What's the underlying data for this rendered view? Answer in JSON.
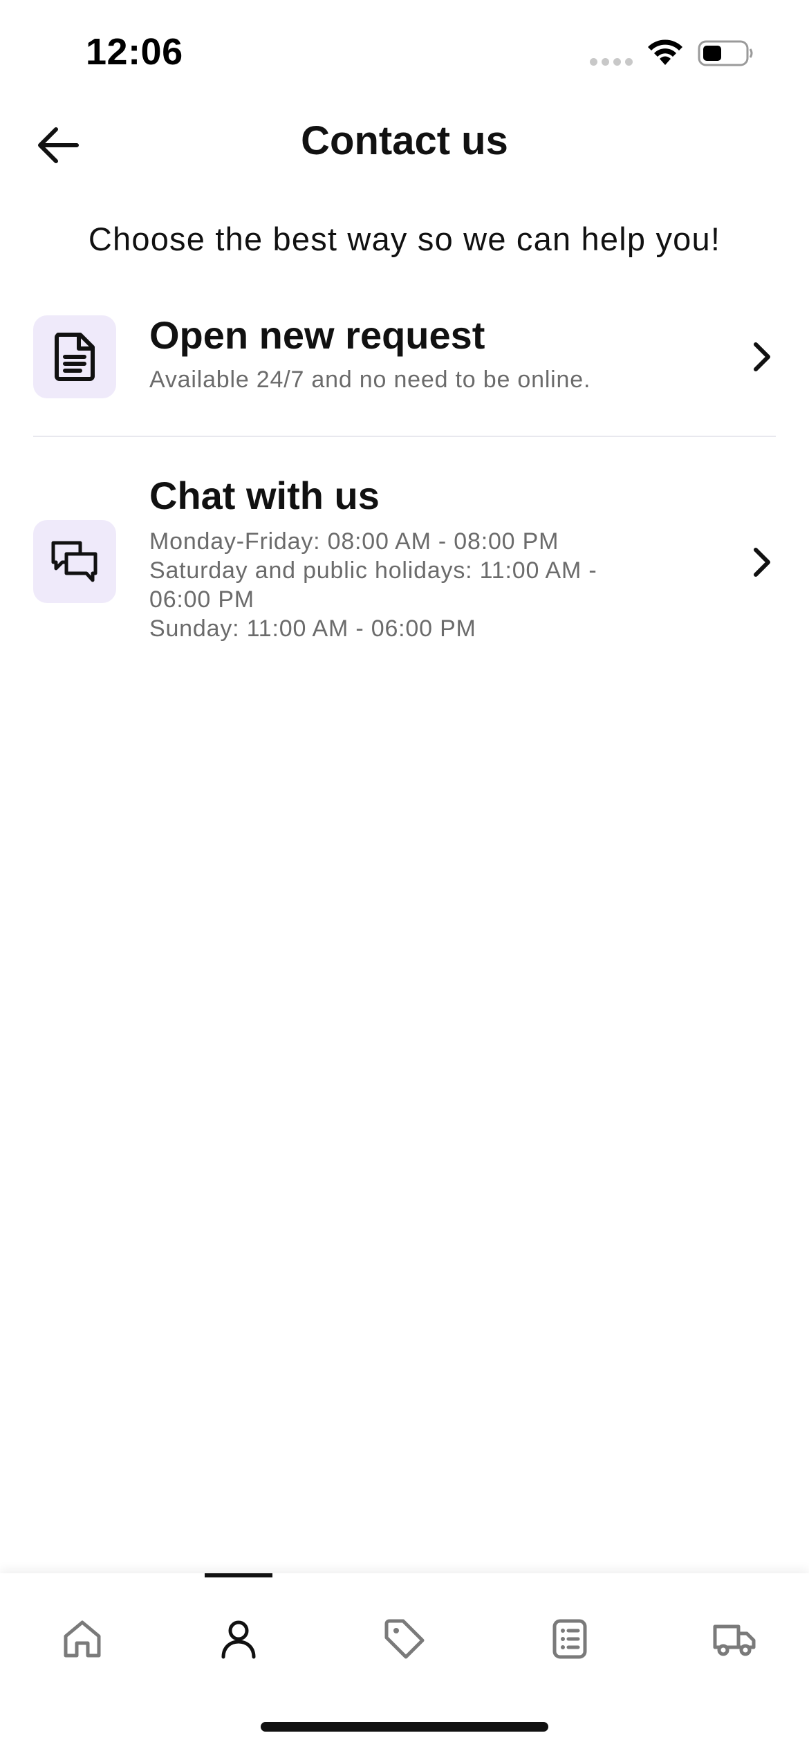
{
  "status_bar": {
    "time": "12:06",
    "icons": [
      "cellular-dots-icon",
      "wifi-icon",
      "battery-icon"
    ]
  },
  "header": {
    "back_icon": "arrow-left-icon",
    "title": "Contact us"
  },
  "subtitle": "Choose the best way so we can help you!",
  "options": [
    {
      "icon": "document-icon",
      "title": "Open new request",
      "description": "Available 24/7 and no need to be online.",
      "chevron": "chevron-right-icon"
    },
    {
      "icon": "chat-bubbles-icon",
      "title": "Chat with us",
      "description": "Monday-Friday: 08:00 AM - 08:00 PM\nSaturday and public holidays: 11:00 AM -\n06:00 PM\nSunday: 11:00 AM - 06:00 PM",
      "chevron": "chevron-right-icon"
    }
  ],
  "tab_bar": {
    "tabs": [
      {
        "icon": "home-icon",
        "active": false
      },
      {
        "icon": "profile-icon",
        "active": true
      },
      {
        "icon": "tag-icon",
        "active": false
      },
      {
        "icon": "list-icon",
        "active": false
      },
      {
        "icon": "truck-icon",
        "active": false
      }
    ]
  },
  "colors": {
    "icon_box_bg": "#efeafa",
    "text_primary": "#111111",
    "text_secondary": "#6b6b6b",
    "tab_icon_inactive": "#7a7a7a",
    "tab_icon_active": "#111111"
  }
}
